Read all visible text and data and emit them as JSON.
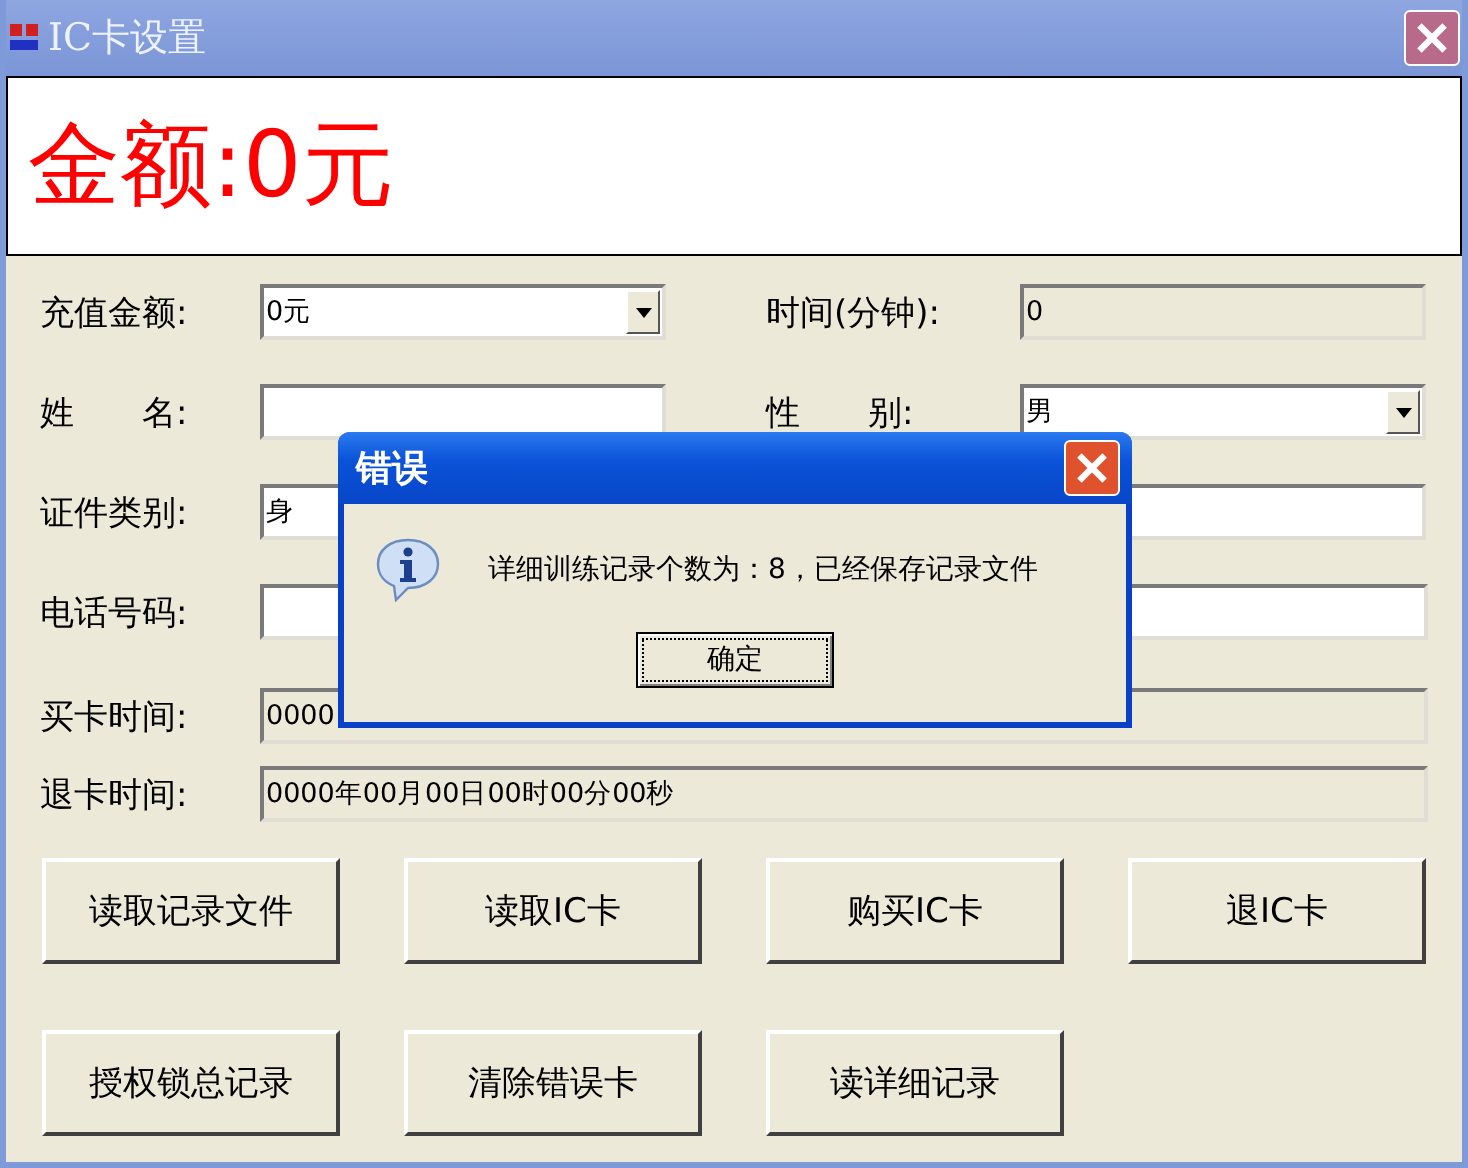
{
  "window": {
    "title": "IC卡设置"
  },
  "amount_display": "金额:0元",
  "rows": [
    {
      "cells": [
        {
          "label": "充值金额:",
          "kind": "combo",
          "value": "0元"
        },
        {
          "label": "时间(分钟):",
          "kind": "readonly",
          "value": "0"
        }
      ]
    },
    {
      "cells": [
        {
          "label": "姓　　名:",
          "kind": "text"
        },
        {
          "label": "性　　别:",
          "kind": "combo",
          "value": "男"
        }
      ]
    },
    {
      "cells": [
        {
          "label": "证件类别:",
          "kind": "text",
          "value": "身"
        },
        {
          "kind": "text"
        }
      ]
    },
    {
      "cells": [
        {
          "label": "电话号码:",
          "kind": "text"
        }
      ]
    },
    {
      "cells": [
        {
          "label": "买卡时间:",
          "kind": "readonly",
          "value": "0000"
        }
      ]
    },
    {
      "cells": [
        {
          "label": "退卡时间:",
          "kind": "readonly",
          "value": "0000年00月00日00时00分00秒"
        }
      ]
    }
  ],
  "buttons": [
    [
      "读取记录文件",
      "读取IC卡",
      "购买IC卡",
      "退IC卡"
    ],
    [
      "授权锁总记录",
      "清除错误卡",
      "读详细记录"
    ]
  ],
  "dialog": {
    "title": "错误",
    "message": "详细训练记录个数为：8，已经保存记录文件",
    "button": "确定"
  }
}
